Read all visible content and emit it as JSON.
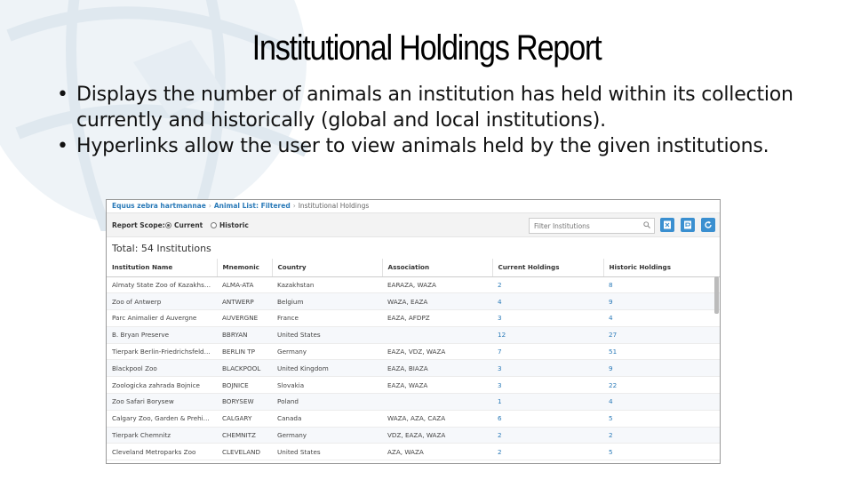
{
  "slide": {
    "title": "Institutional Holdings Report",
    "bullets": [
      "Displays the number of animals an institution has held within its collection currently and historically (global and local institutions).",
      "Hyperlinks allow the user to view animals held by the given institutions."
    ]
  },
  "breadcrumb": {
    "items": [
      "Equus zebra hartmannae",
      "Animal List: Filtered",
      "Institutional Holdings"
    ]
  },
  "toolbar": {
    "scope_label": "Report Scope:",
    "options": [
      "Current",
      "Historic"
    ],
    "selected": "Current",
    "filter_placeholder": "Filter Institutions"
  },
  "total": "Total: 54 Institutions",
  "table": {
    "columns": [
      "Institution Name",
      "Mnemonic",
      "Country",
      "Association",
      "Current Holdings",
      "Historic Holdings"
    ],
    "rows": [
      [
        "Almaty State Zoo of Kazakhstan",
        "ALMA-ATA",
        "Kazakhstan",
        "EARAZA, WAZA",
        "2",
        "8"
      ],
      [
        "Zoo of Antwerp",
        "ANTWERP",
        "Belgium",
        "WAZA, EAZA",
        "4",
        "9"
      ],
      [
        "Parc Animalier d Auvergne",
        "AUVERGNE",
        "France",
        "EAZA, AFDPZ",
        "3",
        "4"
      ],
      [
        "B. Bryan Preserve",
        "BBRYAN",
        "United States",
        "",
        "12",
        "27"
      ],
      [
        "Tierpark Berlin-Friedrichsfelde ...",
        "BERLIN TP",
        "Germany",
        "EAZA, VDZ, WAZA",
        "7",
        "51"
      ],
      [
        "Blackpool Zoo",
        "BLACKPOOL",
        "United Kingdom",
        "EAZA, BIAZA",
        "3",
        "9"
      ],
      [
        "Zoologicka zahrada Bojnice",
        "BOJNICE",
        "Slovakia",
        "EAZA, WAZA",
        "3",
        "22"
      ],
      [
        "Zoo Safari Borysew",
        "BORYSEW",
        "Poland",
        "",
        "1",
        "4"
      ],
      [
        "Calgary Zoo, Garden & Prehisto...",
        "CALGARY",
        "Canada",
        "WAZA, AZA, CAZA",
        "6",
        "5"
      ],
      [
        "Tierpark Chemnitz",
        "CHEMNITZ",
        "Germany",
        "VDZ, EAZA, WAZA",
        "2",
        "2"
      ],
      [
        "Cleveland Metroparks Zoo",
        "CLEVELAND",
        "United States",
        "AZA, WAZA",
        "2",
        "5"
      ]
    ]
  },
  "colors": {
    "link": "#2a7ab8",
    "button": "#3a8fd0"
  }
}
